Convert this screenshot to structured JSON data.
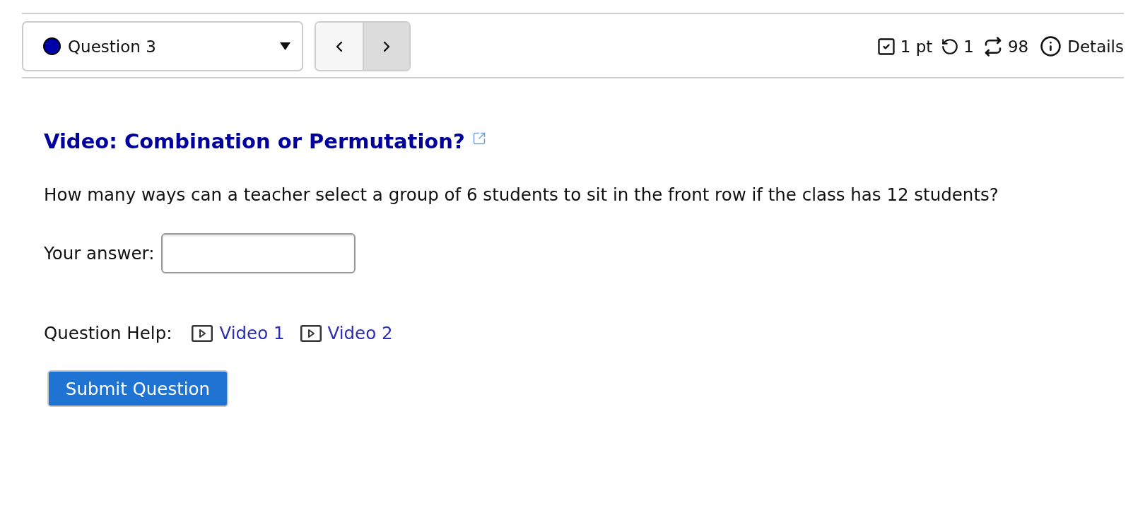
{
  "question_selector": {
    "label": "Question 3",
    "color": "#0000aa"
  },
  "nav_buttons": [
    {
      "kind": "prev",
      "highlighted": false
    },
    {
      "kind": "next",
      "highlighted": true
    }
  ],
  "stats": [
    {
      "kind": "points",
      "text": "1 pt"
    },
    {
      "kind": "attempts",
      "text": "1"
    },
    {
      "kind": "versions",
      "text": "98"
    },
    {
      "kind": "details",
      "text": "Details"
    }
  ],
  "question": {
    "title": "Video: Combination or Permutation?",
    "text": "How many ways can a teacher select a group of 6 students to sit in the front row if the class has 12 students?"
  },
  "answer": {
    "label": "Your answer:"
  },
  "help": {
    "label": "Question Help:",
    "links": [
      "Video 1",
      "Video 2"
    ]
  },
  "submit": {
    "label": "Submit Question"
  }
}
